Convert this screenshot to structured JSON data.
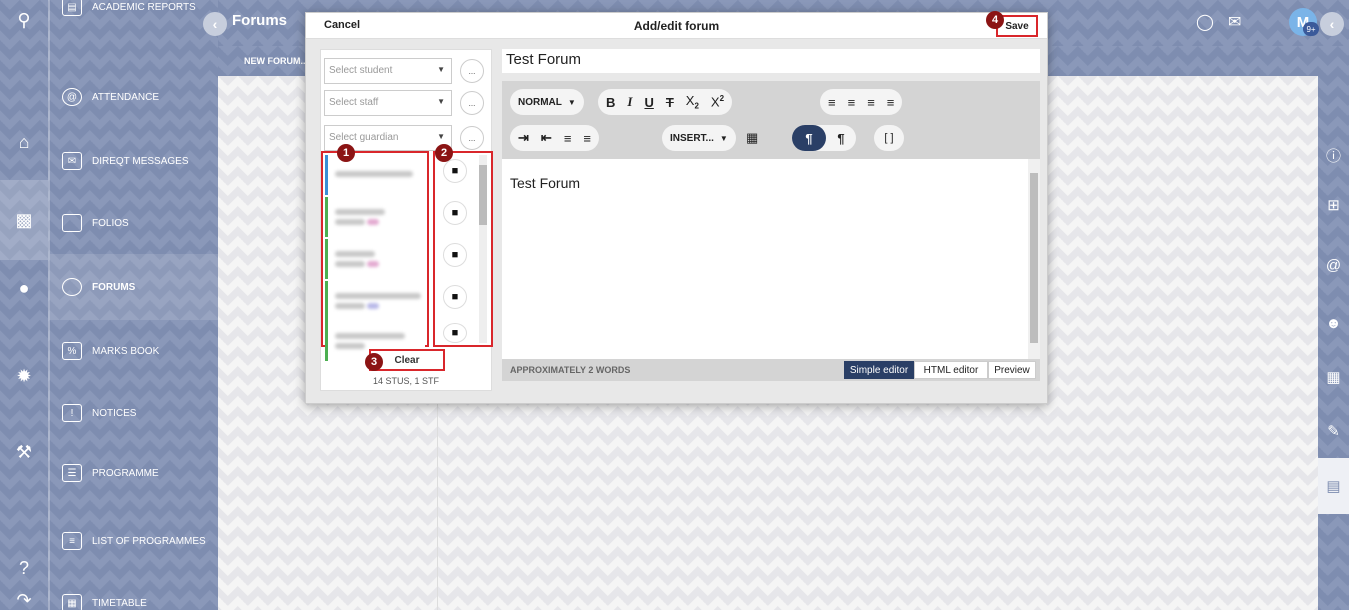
{
  "header": {
    "page_title": "Forums",
    "sub_action": "NEW FORUM..."
  },
  "nav": {
    "items": [
      {
        "label": "ACADEMIC REPORTS",
        "icon": "report-icon"
      },
      {
        "label": "ATTENDANCE",
        "icon": "at-icon"
      },
      {
        "label": "DIREQT MESSAGES",
        "icon": "envelope-icon"
      },
      {
        "label": "FOLIOS",
        "icon": "folder-icon"
      },
      {
        "label": "FORUMS",
        "icon": "chat-icon"
      },
      {
        "label": "MARKS BOOK",
        "icon": "marks-icon"
      },
      {
        "label": "NOTICES",
        "icon": "notice-icon"
      },
      {
        "label": "PROGRAMME",
        "icon": "book-icon"
      },
      {
        "label": "LIST OF PROGRAMMES",
        "icon": "list-icon"
      },
      {
        "label": "TIMETABLE",
        "icon": "calendar-icon"
      }
    ],
    "active": "FORUMS"
  },
  "user": {
    "avatar_initial": "M",
    "badge": "9+"
  },
  "modal": {
    "cancel_label": "Cancel",
    "title": "Add/edit forum",
    "save_label": "Save",
    "select_student_placeholder": "Select student",
    "select_staff_placeholder": "Select staff",
    "select_guardian_placeholder": "Select guardian",
    "more_label": "...",
    "clear_label": "Clear",
    "count_text": "14 STUS, 1 STF",
    "forum_title": "Test Forum",
    "body_text": "Test Forum",
    "word_count": "APPROXIMATELY 2 WORDS",
    "modes": [
      "Simple editor",
      "HTML editor",
      "Preview"
    ],
    "active_mode": "Simple editor",
    "toolbar": {
      "style_label": "NORMAL",
      "insert_label": "INSERT..."
    },
    "people_bar_colors": [
      "#3a8fd6",
      "#4caf50",
      "#4caf50",
      "#4caf50",
      "#4caf50",
      "#4caf50"
    ]
  },
  "callouts": [
    "1",
    "2",
    "3",
    "4"
  ],
  "colors": {
    "sidebar": "#7e8db0",
    "accent_dark": "#2a3f66",
    "highlight_red": "#d9262b",
    "callout": "#8b1414"
  }
}
